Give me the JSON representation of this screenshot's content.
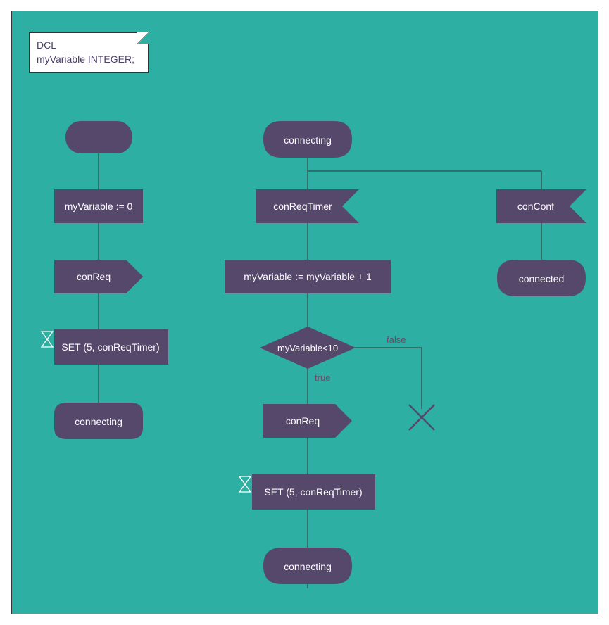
{
  "note": {
    "line1": "DCL",
    "line2": "myVariable INTEGER;"
  },
  "col1": {
    "assign": "myVariable := 0",
    "send": "conReq",
    "set": "SET (5, conReqTimer)",
    "state": "connecting"
  },
  "col2": {
    "top_state": "connecting",
    "recv": "conReqTimer",
    "assign": "myVariable := myVariable + 1",
    "decision": "myVariable<10",
    "true": "true",
    "false": "false",
    "send": "conReq",
    "set": "SET (5, conReqTimer)",
    "state": "connecting"
  },
  "col3": {
    "recv": "conConf",
    "state": "connected"
  },
  "colors": {
    "fill": "#55486b",
    "text": "#ffffff",
    "bg": "#2db0a3",
    "edge": "#6d4a6a"
  }
}
